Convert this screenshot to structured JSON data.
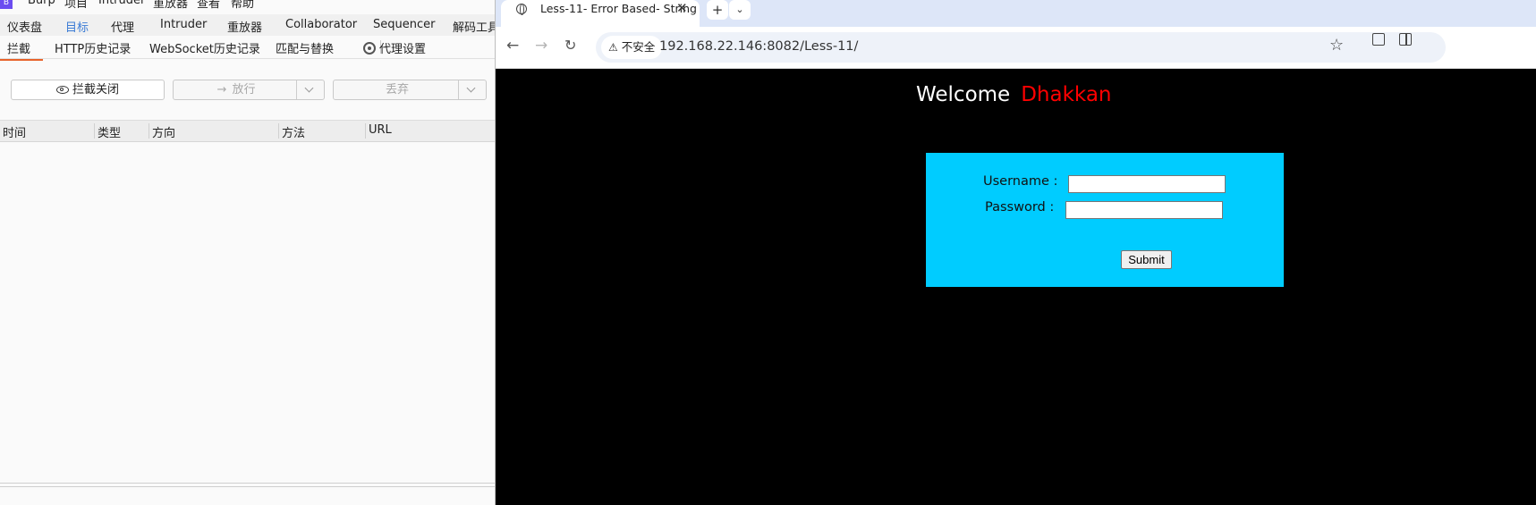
{
  "burp": {
    "menu": [
      "Burp",
      "项目",
      "Intruder",
      "重放器",
      "查看",
      "帮助"
    ],
    "main_tabs": [
      "仪表盘",
      "目标",
      "代理",
      "Intruder",
      "重放器",
      "Collaborator",
      "Sequencer",
      "解码工具"
    ],
    "sub_tabs": [
      "拦截",
      "HTTP历史记录",
      "WebSocket历史记录",
      "匹配与替换",
      "代理设置"
    ],
    "buttons": {
      "intercept": "拦截关闭",
      "forward": "放行",
      "drop": "丢弃"
    },
    "table_headers": [
      "时间",
      "类型",
      "方向",
      "方法",
      "URL"
    ]
  },
  "browser": {
    "tab_title": "Less-11- Error Based- String",
    "security_label": "不安全",
    "url": "192.168.22.146:8082/Less-11/",
    "page": {
      "welcome": "Welcome",
      "name": "Dhakkan",
      "username_label": "Username :",
      "password_label": "Password :",
      "username_value": "",
      "password_value": "",
      "submit_label": "Submit"
    }
  }
}
